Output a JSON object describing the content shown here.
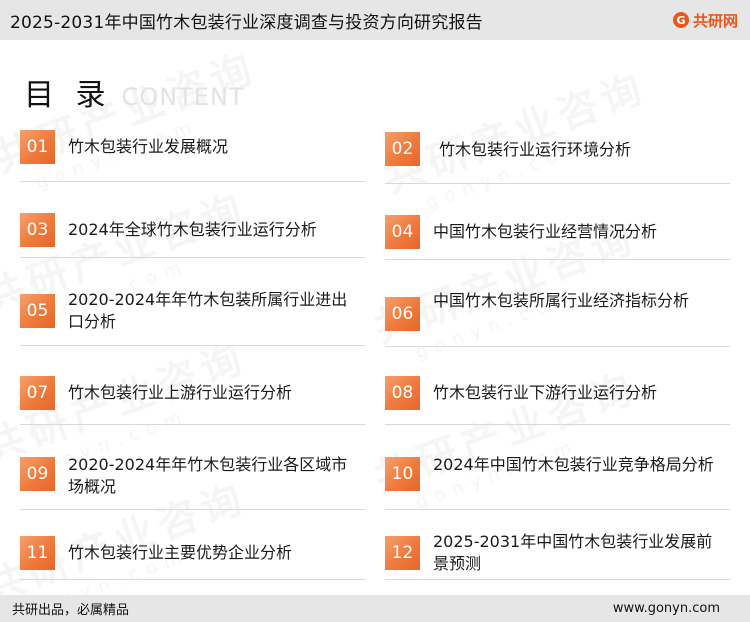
{
  "header": {
    "title": "2025-2031年中国竹木包装行业深度调查与投资方向研究报告",
    "brand": "共研网",
    "brand_icon": "G"
  },
  "watermark": {
    "text": "共研产业咨询",
    "sub": "gonyn.com"
  },
  "toc": {
    "title": "目 录",
    "subtitle": "CONTENT",
    "items": [
      {
        "num": "01",
        "label": "竹木包装行业发展概况"
      },
      {
        "num": "02",
        "label": "竹木包装行业运行环境分析"
      },
      {
        "num": "03",
        "label": "2024年全球竹木包装行业运行分析"
      },
      {
        "num": "04",
        "label": "中国竹木包装行业经营情况分析"
      },
      {
        "num": "05",
        "label": "2020-2024年年竹木包装所属行业进出口分析"
      },
      {
        "num": "06",
        "label": "中国竹木包装所属行业经济指标分析"
      },
      {
        "num": "07",
        "label": "竹木包装行业上游行业运行分析"
      },
      {
        "num": "08",
        "label": "竹木包装行业下游行业运行分析"
      },
      {
        "num": "09",
        "label": "2020-2024年年竹木包装行业各区域市场概况"
      },
      {
        "num": "10",
        "label": "2024年中国竹木包装行业竞争格局分析"
      },
      {
        "num": "11",
        "label": "竹木包装行业主要优势企业分析"
      },
      {
        "num": "12",
        "label": "2025-2031年中国竹木包装行业发展前景预测"
      }
    ]
  },
  "footer": {
    "slogan": "共研出品，必属精品",
    "url": "www.gonyn.com"
  },
  "colors": {
    "accent": "#ee7a3c",
    "bar": "#e6e6e6"
  }
}
